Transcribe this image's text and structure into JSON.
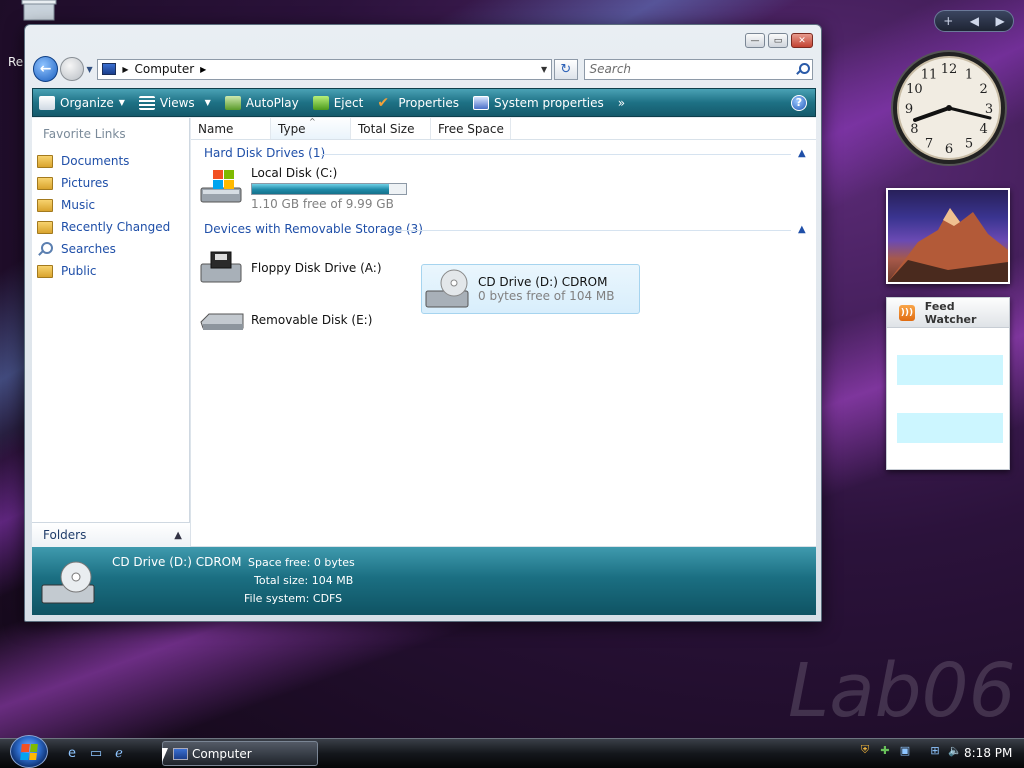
{
  "desktop": {
    "icon_label": "Re",
    "watermark": "Lab06"
  },
  "window": {
    "address": "Computer",
    "search_placeholder": "Search"
  },
  "toolbar": {
    "organize": "Organize",
    "views": "Views",
    "autoplay": "AutoPlay",
    "eject": "Eject",
    "properties": "Properties",
    "system_properties": "System properties",
    "more": "»",
    "help": "?"
  },
  "nav": {
    "favorite_links_title": "Favorite Links",
    "items": [
      {
        "label": "Documents",
        "icon": "folder-icon"
      },
      {
        "label": "Pictures",
        "icon": "folder-icon"
      },
      {
        "label": "Music",
        "icon": "folder-icon"
      },
      {
        "label": "Recently Changed",
        "icon": "folder-icon"
      },
      {
        "label": "Searches",
        "icon": "search-icon"
      },
      {
        "label": "Public",
        "icon": "folder-icon"
      }
    ],
    "folders_label": "Folders"
  },
  "columns": [
    "Name",
    "Type",
    "Total Size",
    "Free Space"
  ],
  "groups": {
    "hard_disks": {
      "title": "Hard Disk Drives (1)",
      "drives": [
        {
          "name": "Local Disk (C:)",
          "subtitle": "1.10 GB free of 9.99 GB",
          "used_fraction": 0.89
        }
      ]
    },
    "removable": {
      "title": "Devices with Removable Storage (3)",
      "drives": [
        {
          "name": "Floppy Disk Drive (A:)",
          "subtitle": ""
        },
        {
          "name": "CD Drive (D:) CDROM",
          "subtitle": "0 bytes free of 104 MB"
        },
        {
          "name": "Removable Disk (E:)",
          "subtitle": ""
        }
      ]
    }
  },
  "details": {
    "title": "CD Drive (D:) CDROM",
    "space_free_label": "Space free:",
    "space_free_value": "0 bytes",
    "total_size_label": "Total size:",
    "total_size_value": "104 MB",
    "file_system_label": "File system:",
    "file_system_value": "CDFS"
  },
  "gadgets": {
    "clock_numbers": [
      "12",
      "1",
      "2",
      "3",
      "4",
      "5",
      "6",
      "7",
      "8",
      "9",
      "10",
      "11"
    ],
    "feed_title": "Feed Watcher",
    "sidebar_add": "+"
  },
  "taskbar": {
    "task_label": "Computer",
    "time": "8:18 PM"
  }
}
